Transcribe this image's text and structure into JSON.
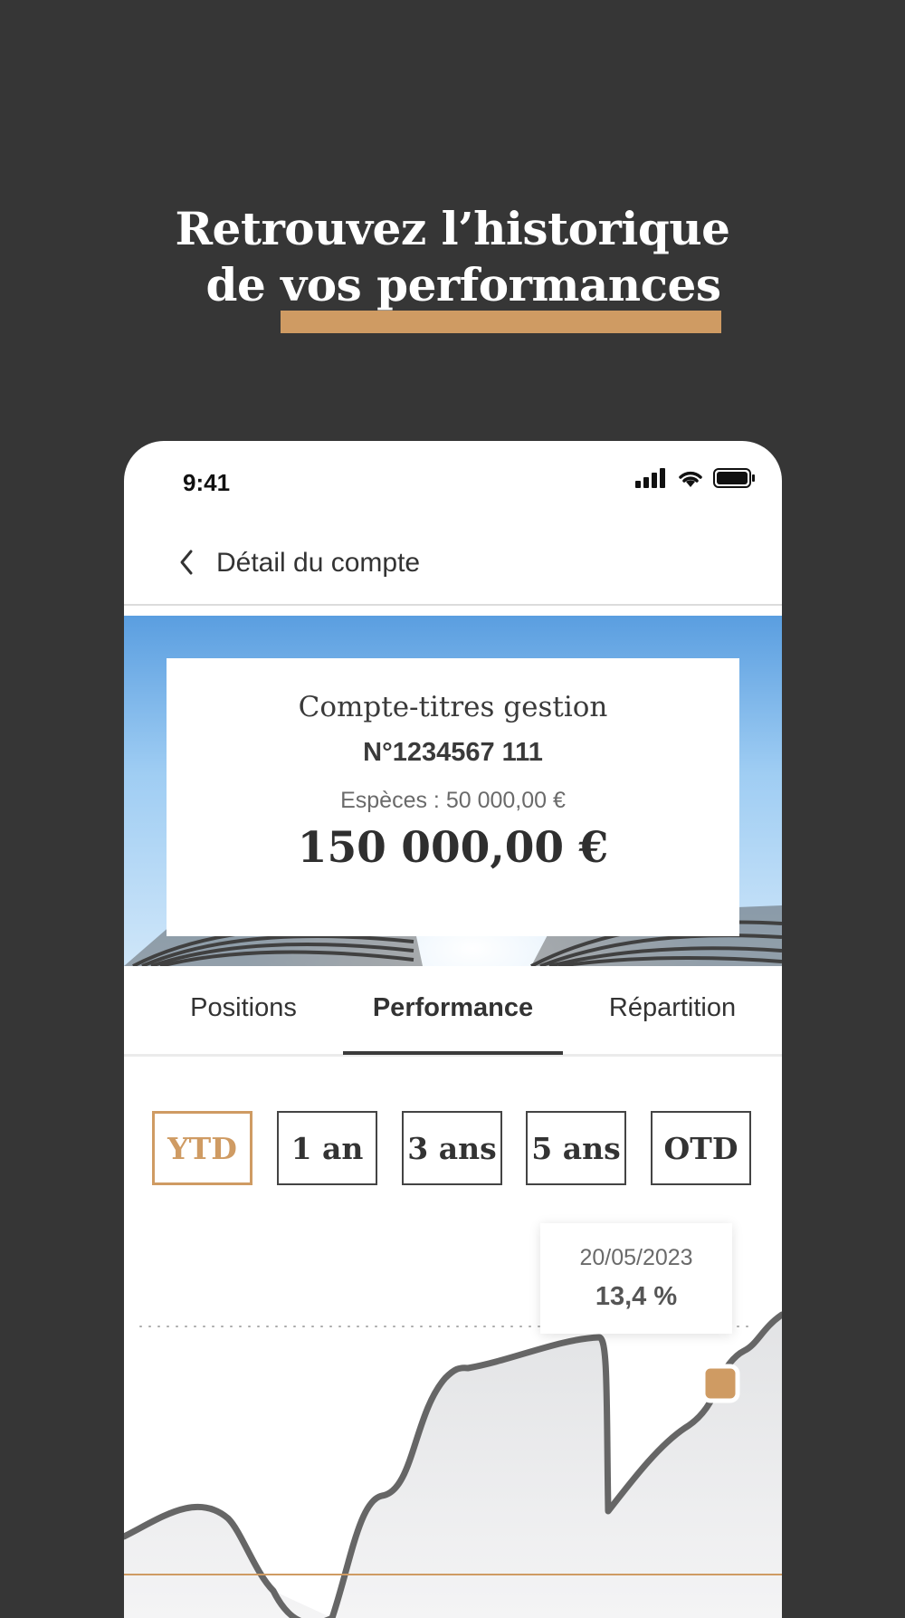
{
  "headline": {
    "line1": "Retrouvez l’historique",
    "line2_prefix": "de ",
    "line2_highlight": "vos performances"
  },
  "status": {
    "time": "9:41"
  },
  "nav": {
    "title": "Détail du compte"
  },
  "account": {
    "name": "Compte-titres gestion",
    "number": "N°1234567 111",
    "cash": "Espèces : 50 000,00 €",
    "total": "150 000,00 €"
  },
  "tabs": [
    "Positions",
    "Performance",
    "Répartition"
  ],
  "active_tab": "Performance",
  "periods": [
    "YTD",
    "1 an",
    "3 ans",
    "5 ans",
    "OTD"
  ],
  "selected_period": "YTD",
  "tooltip": {
    "date": "20/05/2023",
    "value": "13,4 %"
  },
  "colors": {
    "accent": "#cf9b63",
    "background": "#363636",
    "line": "#666666"
  }
}
